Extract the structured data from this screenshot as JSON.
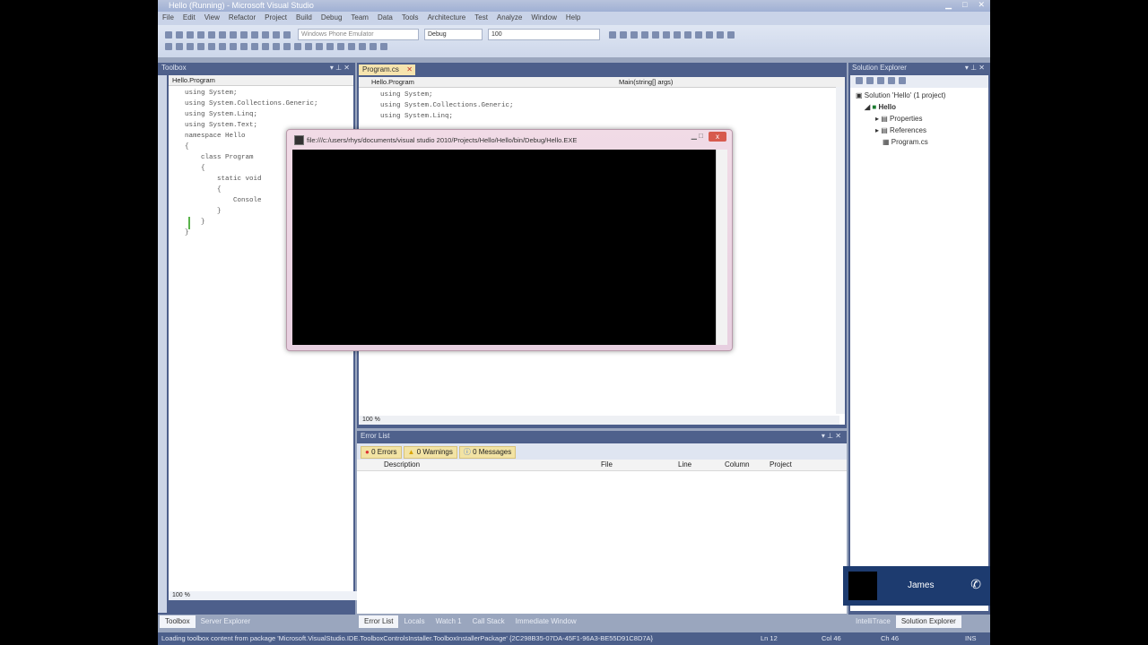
{
  "window": {
    "title": "Hello (Running) - Microsoft Visual Studio"
  },
  "menu": [
    "File",
    "Edit",
    "View",
    "Refactor",
    "Project",
    "Build",
    "Debug",
    "Team",
    "Data",
    "Tools",
    "Architecture",
    "Test",
    "Analyze",
    "Window",
    "Help"
  ],
  "toolbar": {
    "platform_combo": "Windows Phone Emulator",
    "config_combo": "Debug",
    "find_combo": "100"
  },
  "toolbox": {
    "title": "Toolbox",
    "zoom": "100 %",
    "class_combo": "Hello.Program",
    "code": [
      "using System;",
      "using System.Collections.Generic;",
      "using System.Linq;",
      "using System.Text;",
      "",
      "namespace Hello",
      "{",
      "    class Program",
      "    {",
      "        static void",
      "        {",
      "            Console",
      "        }",
      "    }",
      "}"
    ]
  },
  "editor": {
    "tab": "Program.cs",
    "class_combo": "Hello.Program",
    "member_combo": "Main(string[] args)",
    "zoom": "100 %",
    "code": [
      "using System;",
      "using System.Collections.Generic;",
      "using System.Linq;"
    ]
  },
  "console": {
    "title": "file:///c:/users/rhys/documents/visual studio 2010/Projects/Hello/Hello/bin/Debug/Hello.EXE",
    "close": "x"
  },
  "errors": {
    "title": "Error List",
    "tab_errors": "0 Errors",
    "tab_warnings": "0 Warnings",
    "tab_messages": "0 Messages",
    "columns": {
      "description": "Description",
      "file": "File",
      "line": "Line",
      "column": "Column",
      "project": "Project"
    }
  },
  "solution": {
    "title": "Solution Explorer",
    "root": "Solution 'Hello' (1 project)",
    "project": "Hello",
    "items": [
      "Properties",
      "References",
      "Program.cs"
    ]
  },
  "bottom_tabs_left": [
    "Toolbox",
    "Server Explorer"
  ],
  "bottom_tabs_center": [
    "Error List",
    "Locals",
    "Watch 1",
    "Call Stack",
    "Immediate Window"
  ],
  "bottom_tabs_right": [
    "IntelliTrace",
    "Solution Explorer"
  ],
  "status": {
    "message": "Loading toolbox content from package 'Microsoft.VisualStudio.IDE.ToolboxControlsInstaller.ToolboxInstallerPackage' {2C298B35-07DA-45F1-96A3-BE55D91C8D7A}",
    "ln": "Ln 12",
    "col": "Col 46",
    "ch": "Ch 46",
    "ins": "INS"
  },
  "caller": {
    "name": "James"
  }
}
